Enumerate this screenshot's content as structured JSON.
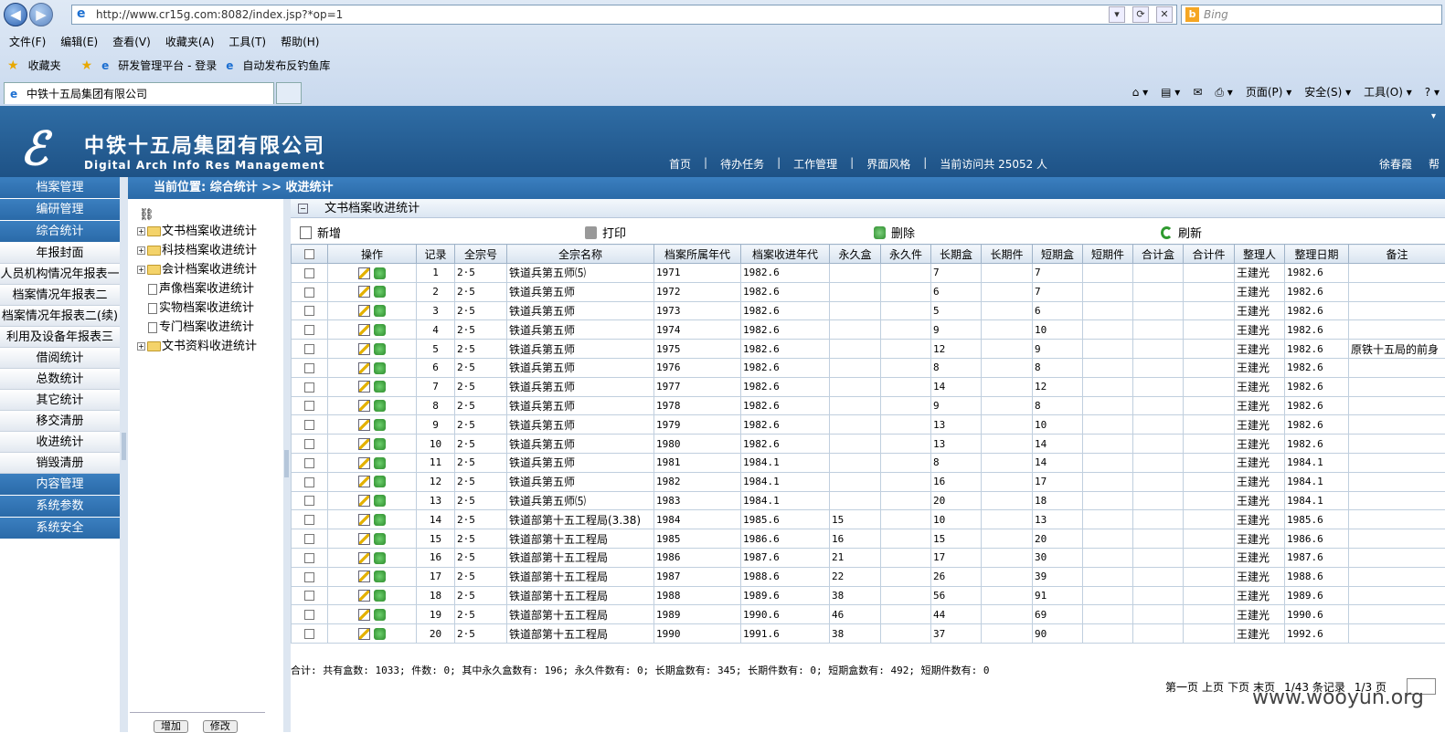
{
  "browser": {
    "url": "http://www.cr15g.com:8082/index.jsp?*op=1",
    "search_placeholder": "Bing",
    "search_logo": "b",
    "menu": [
      "文件(F)",
      "编辑(E)",
      "查看(V)",
      "收藏夹(A)",
      "工具(T)",
      "帮助(H)"
    ],
    "favorites_label": "收藏夹",
    "fav_links": [
      "研发管理平台 - 登录",
      "自动发布反钓鱼库"
    ],
    "tab_title": "中铁十五局集团有限公司",
    "cmd": [
      "页面(P) ▾",
      "安全(S) ▾",
      "工具(O) ▾",
      "? ▾"
    ],
    "back_glyph": "◀",
    "fwd_glyph": "▶",
    "ie_glyph": "e",
    "star_glyph": "★",
    "home_glyph": "⌂ ▾",
    "feed_glyph": "▤ ▾",
    "mail_glyph": "✉",
    "print_glyph": "⎙ ▾",
    "addr_tools": [
      "▾",
      "⟳",
      "✕"
    ]
  },
  "header": {
    "logo": "ℰ",
    "title_cn": "中铁十五局集团有限公司",
    "title_en": "Digital Arch Info Res Management",
    "nav": [
      "首页",
      "待办任务",
      "工作管理",
      "界面风格"
    ],
    "nav_sep": "|",
    "visits": "当前访问共 25052 人",
    "user": "徐春霞",
    "help": "帮",
    "collapse": "▾"
  },
  "sidebar": {
    "items": [
      {
        "label": "档案管理",
        "type": "main"
      },
      {
        "label": "编研管理",
        "type": "main"
      },
      {
        "label": "综合统计",
        "type": "main"
      },
      {
        "label": "年报封面",
        "type": "sub"
      },
      {
        "label": "人员机构情况年报表一",
        "type": "sub"
      },
      {
        "label": "档案情况年报表二",
        "type": "sub"
      },
      {
        "label": "档案情况年报表二(续)",
        "type": "sub"
      },
      {
        "label": "利用及设备年报表三",
        "type": "sub"
      },
      {
        "label": "借阅统计",
        "type": "sub"
      },
      {
        "label": "总数统计",
        "type": "sub"
      },
      {
        "label": "其它统计",
        "type": "sub"
      },
      {
        "label": "移交清册",
        "type": "sub"
      },
      {
        "label": "收进统计",
        "type": "sub"
      },
      {
        "label": "销毁清册",
        "type": "sub"
      },
      {
        "label": "内容管理",
        "type": "main"
      },
      {
        "label": "系统参数",
        "type": "main"
      },
      {
        "label": "系统安全",
        "type": "main"
      }
    ]
  },
  "breadcrumb": "当前位置: 综合统计 >> 收进统计",
  "tree": {
    "root_icon": "⛓",
    "plus": "+",
    "items": [
      {
        "label": "文书档案收进统计",
        "kind": "folder"
      },
      {
        "label": "科技档案收进统计",
        "kind": "folder"
      },
      {
        "label": "会计档案收进统计",
        "kind": "folder"
      },
      {
        "label": "声像档案收进统计",
        "kind": "doc"
      },
      {
        "label": "实物档案收进统计",
        "kind": "doc"
      },
      {
        "label": "专门档案收进统计",
        "kind": "doc"
      },
      {
        "label": "文书资料收进统计",
        "kind": "folder"
      }
    ],
    "bottom_buttons": [
      "增加",
      "修改"
    ]
  },
  "content": {
    "title": "文书档案收进统计",
    "collapse_box": "−",
    "toolbar": {
      "new": "新增",
      "print": "打印",
      "delete": "删除",
      "refresh": "刷新"
    },
    "columns": [
      "操作",
      "记录",
      "全宗号",
      "全宗名称",
      "档案所属年代",
      "档案收进年代",
      "永久盒",
      "永久件",
      "长期盒",
      "长期件",
      "短期盒",
      "短期件",
      "合计盒",
      "合计件",
      "整理人",
      "整理日期",
      "备注"
    ],
    "rows": [
      [
        "1",
        "2·5",
        "铁道兵第五师⑸",
        "1971",
        "1982.6",
        "",
        "",
        "7",
        "",
        "7",
        "",
        "",
        "",
        "王建光",
        "1982.6",
        ""
      ],
      [
        "2",
        "2·5",
        "铁道兵第五师",
        "1972",
        "1982.6",
        "",
        "",
        "6",
        "",
        "7",
        "",
        "",
        "",
        "王建光",
        "1982.6",
        ""
      ],
      [
        "3",
        "2·5",
        "铁道兵第五师",
        "1973",
        "1982.6",
        "",
        "",
        "5",
        "",
        "6",
        "",
        "",
        "",
        "王建光",
        "1982.6",
        ""
      ],
      [
        "4",
        "2·5",
        "铁道兵第五师",
        "1974",
        "1982.6",
        "",
        "",
        "9",
        "",
        "10",
        "",
        "",
        "",
        "王建光",
        "1982.6",
        ""
      ],
      [
        "5",
        "2·5",
        "铁道兵第五师",
        "1975",
        "1982.6",
        "",
        "",
        "12",
        "",
        "9",
        "",
        "",
        "",
        "王建光",
        "1982.6",
        "原铁十五局的前身"
      ],
      [
        "6",
        "2·5",
        "铁道兵第五师",
        "1976",
        "1982.6",
        "",
        "",
        "8",
        "",
        "8",
        "",
        "",
        "",
        "王建光",
        "1982.6",
        ""
      ],
      [
        "7",
        "2·5",
        "铁道兵第五师",
        "1977",
        "1982.6",
        "",
        "",
        "14",
        "",
        "12",
        "",
        "",
        "",
        "王建光",
        "1982.6",
        ""
      ],
      [
        "8",
        "2·5",
        "铁道兵第五师",
        "1978",
        "1982.6",
        "",
        "",
        "9",
        "",
        "8",
        "",
        "",
        "",
        "王建光",
        "1982.6",
        ""
      ],
      [
        "9",
        "2·5",
        "铁道兵第五师",
        "1979",
        "1982.6",
        "",
        "",
        "13",
        "",
        "10",
        "",
        "",
        "",
        "王建光",
        "1982.6",
        ""
      ],
      [
        "10",
        "2·5",
        "铁道兵第五师",
        "1980",
        "1982.6",
        "",
        "",
        "13",
        "",
        "14",
        "",
        "",
        "",
        "王建光",
        "1982.6",
        ""
      ],
      [
        "11",
        "2·5",
        "铁道兵第五师",
        "1981",
        "1984.1",
        "",
        "",
        "8",
        "",
        "14",
        "",
        "",
        "",
        "王建光",
        "1984.1",
        ""
      ],
      [
        "12",
        "2·5",
        "铁道兵第五师",
        "1982",
        "1984.1",
        "",
        "",
        "16",
        "",
        "17",
        "",
        "",
        "",
        "王建光",
        "1984.1",
        ""
      ],
      [
        "13",
        "2·5",
        "铁道兵第五师⑸",
        "1983",
        "1984.1",
        "",
        "",
        "20",
        "",
        "18",
        "",
        "",
        "",
        "王建光",
        "1984.1",
        ""
      ],
      [
        "14",
        "2·5",
        "铁道部第十五工程局(3.38)",
        "1984",
        "1985.6",
        "15",
        "",
        "10",
        "",
        "13",
        "",
        "",
        "",
        "王建光",
        "1985.6",
        ""
      ],
      [
        "15",
        "2·5",
        "铁道部第十五工程局",
        "1985",
        "1986.6",
        "16",
        "",
        "15",
        "",
        "20",
        "",
        "",
        "",
        "王建光",
        "1986.6",
        ""
      ],
      [
        "16",
        "2·5",
        "铁道部第十五工程局",
        "1986",
        "1987.6",
        "21",
        "",
        "17",
        "",
        "30",
        "",
        "",
        "",
        "王建光",
        "1987.6",
        ""
      ],
      [
        "17",
        "2·5",
        "铁道部第十五工程局",
        "1987",
        "1988.6",
        "22",
        "",
        "26",
        "",
        "39",
        "",
        "",
        "",
        "王建光",
        "1988.6",
        ""
      ],
      [
        "18",
        "2·5",
        "铁道部第十五工程局",
        "1988",
        "1989.6",
        "38",
        "",
        "56",
        "",
        "91",
        "",
        "",
        "",
        "王建光",
        "1989.6",
        ""
      ],
      [
        "19",
        "2·5",
        "铁道部第十五工程局",
        "1989",
        "1990.6",
        "46",
        "",
        "44",
        "",
        "69",
        "",
        "",
        "",
        "王建光",
        "1990.6",
        ""
      ],
      [
        "20",
        "2·5",
        "铁道部第十五工程局",
        "1990",
        "1991.6",
        "38",
        "",
        "37",
        "",
        "90",
        "",
        "",
        "",
        "王建光",
        "1992.6",
        ""
      ]
    ],
    "summary": "合计: 共有盒数: 1033; 件数: 0; 其中永久盒数有: 196; 永久件数有: 0; 长期盒数有: 345; 长期件数有: 0; 短期盒数有: 492; 短期件数有: 0",
    "pager": [
      "第一页",
      "上页",
      "下页",
      "末页",
      "1/43 条记录",
      "1/3 页"
    ]
  },
  "watermark": "www.wooyun.org",
  "colors": {
    "accent": "#2a6aa8",
    "banner": "#1e5286"
  }
}
